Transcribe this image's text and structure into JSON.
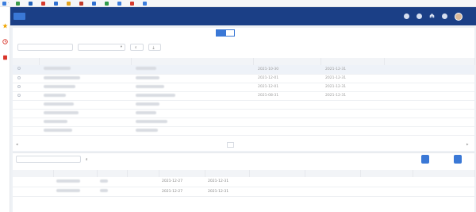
{
  "bookmarks": [
    {
      "label": "·",
      "color": "#3b7ddd"
    },
    {
      "label": "",
      "color": "#3a9a4a"
    },
    {
      "label": "",
      "color": "#2060b8"
    },
    {
      "label": "",
      "color": "#d63b2e"
    },
    {
      "label": "",
      "color": "#2f6fd0"
    },
    {
      "label": "",
      "color": "#e2a21e"
    },
    {
      "label": "",
      "color": "#c03a2b"
    },
    {
      "label": "",
      "color": "#2f6fd0"
    },
    {
      "label": "",
      "color": "#2f9b4a"
    },
    {
      "label": "",
      "color": "#3b7ddd"
    },
    {
      "label": "",
      "color": "#d63b2e"
    },
    {
      "label": "",
      "color": "#3b7ddd"
    }
  ],
  "tabs": [
    "",
    ""
  ],
  "filters": {
    "field1_placeholder": "",
    "search_label": "",
    "export_label": ""
  },
  "grid": {
    "rows": [
      {
        "col3": "2021-10-30",
        "col4": "2021-12-31",
        "selected": true
      },
      {
        "col3": "2021-12-01",
        "col4": "2021-12-31",
        "selected": true
      },
      {
        "col3": "2021-12-01",
        "col4": "2021-12-31",
        "selected": true
      },
      {
        "col3": "2021-08-31",
        "col4": "2021-12-31",
        "selected": true
      },
      {
        "col3": "",
        "col4": "",
        "selected": false
      },
      {
        "col3": "",
        "col4": "",
        "selected": false
      },
      {
        "col3": "",
        "col4": "",
        "selected": false
      },
      {
        "col3": "",
        "col4": "",
        "selected": false
      }
    ]
  },
  "panel": {
    "search_label": "",
    "rows": [
      {
        "c1": "",
        "c2": "",
        "c3": "",
        "c4": "",
        "c5": "2021-12-27",
        "c6": "2021-12-31",
        "c7": "",
        "c8": "",
        "c9": ""
      },
      {
        "c1": "",
        "c2": "",
        "c3": "",
        "c4": "",
        "c5": "2021-12-27",
        "c6": "2021-12-31",
        "c7": "",
        "c8": "",
        "c9": ""
      }
    ]
  },
  "colors": {
    "nav": "#1b3f86",
    "accent": "#3a78d6",
    "highlight": "#d9352a"
  }
}
